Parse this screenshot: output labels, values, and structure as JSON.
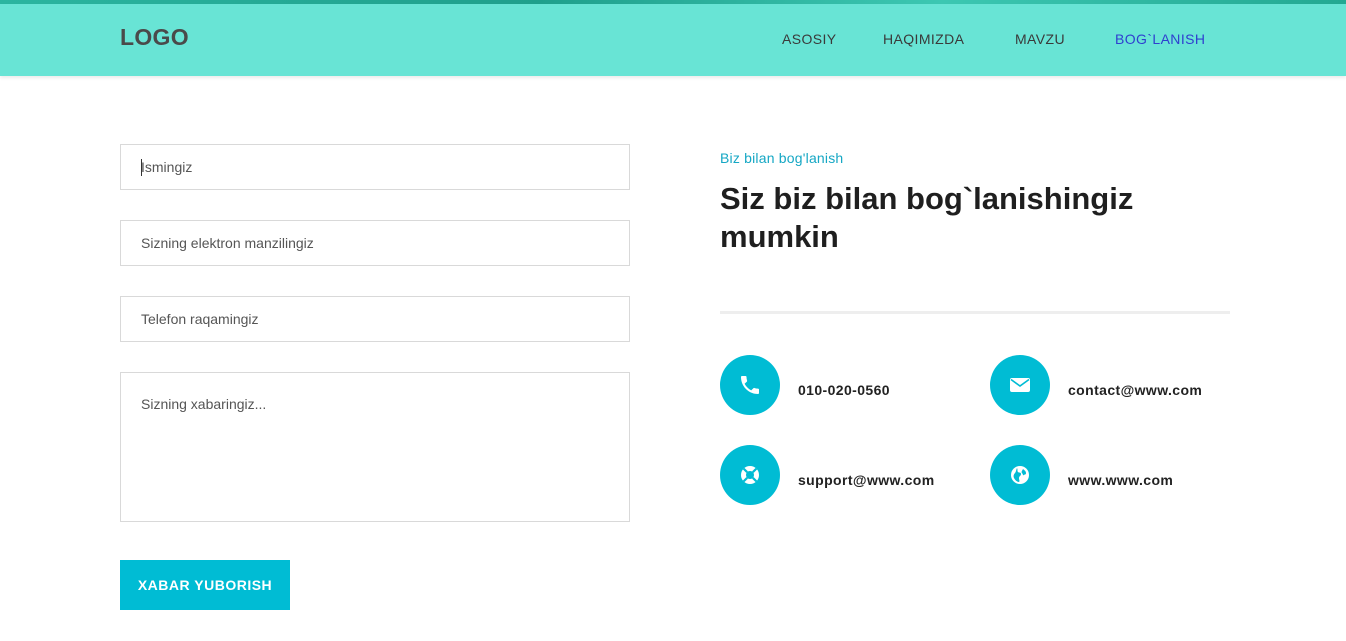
{
  "header": {
    "logo": "LOGO",
    "nav": [
      "ASOSIY",
      "HAQIMIZDA",
      "MAVZU",
      "BOG`LANISH"
    ],
    "active_nav": "BOG`LANISH",
    "bg_color": "#68e4d5"
  },
  "form": {
    "name_placeholder": "Ismingiz",
    "email_placeholder": "Sizning elektron manzilingiz",
    "phone_placeholder": "Telefon raqamingiz",
    "message_placeholder": "Sizning xabaringiz...",
    "submit_label": "XABAR YUBORISH"
  },
  "contact": {
    "subtitle": "Biz bilan bog'lanish",
    "title": "Siz biz bilan bog`lanishingiz mumkin",
    "phone": "010-020-0560",
    "email": "contact@www.com",
    "support": "support@www.com",
    "website": "www.www.com",
    "icons": [
      "phone-icon",
      "envelope-icon",
      "lifebuoy-icon",
      "globe-icon"
    ]
  },
  "colors": {
    "accent": "#00bcd4",
    "active_link": "#2f3fd0"
  }
}
